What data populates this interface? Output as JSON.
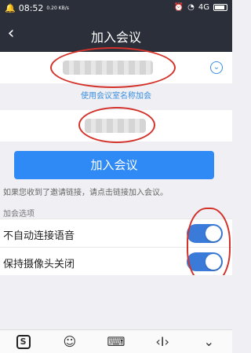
{
  "status": {
    "time": "08:52",
    "speed": "0.20 KB/s",
    "signal": "4G",
    "battery": ""
  },
  "header": {
    "back_icon": "‹",
    "title": "加入会议"
  },
  "meeting_id": {
    "value": ""
  },
  "link_text": "使用会议室名称加会",
  "name": {
    "value": ""
  },
  "join_button": "加入会议",
  "hint": "如果您收到了邀请链接，请点击链接加入会议。",
  "options": {
    "section_title": "加会选项",
    "items": [
      {
        "label": "不自动连接语音",
        "checked": true
      },
      {
        "label": "保持摄像头关闭",
        "checked": true
      }
    ]
  },
  "toolbar": {
    "sogou_label": "S",
    "emoji_icon": "smile-icon",
    "keyboard_icon": "keyboard-icon",
    "cursor_icon": "cursor-icon",
    "collapse_icon": "chevron-down-icon"
  }
}
